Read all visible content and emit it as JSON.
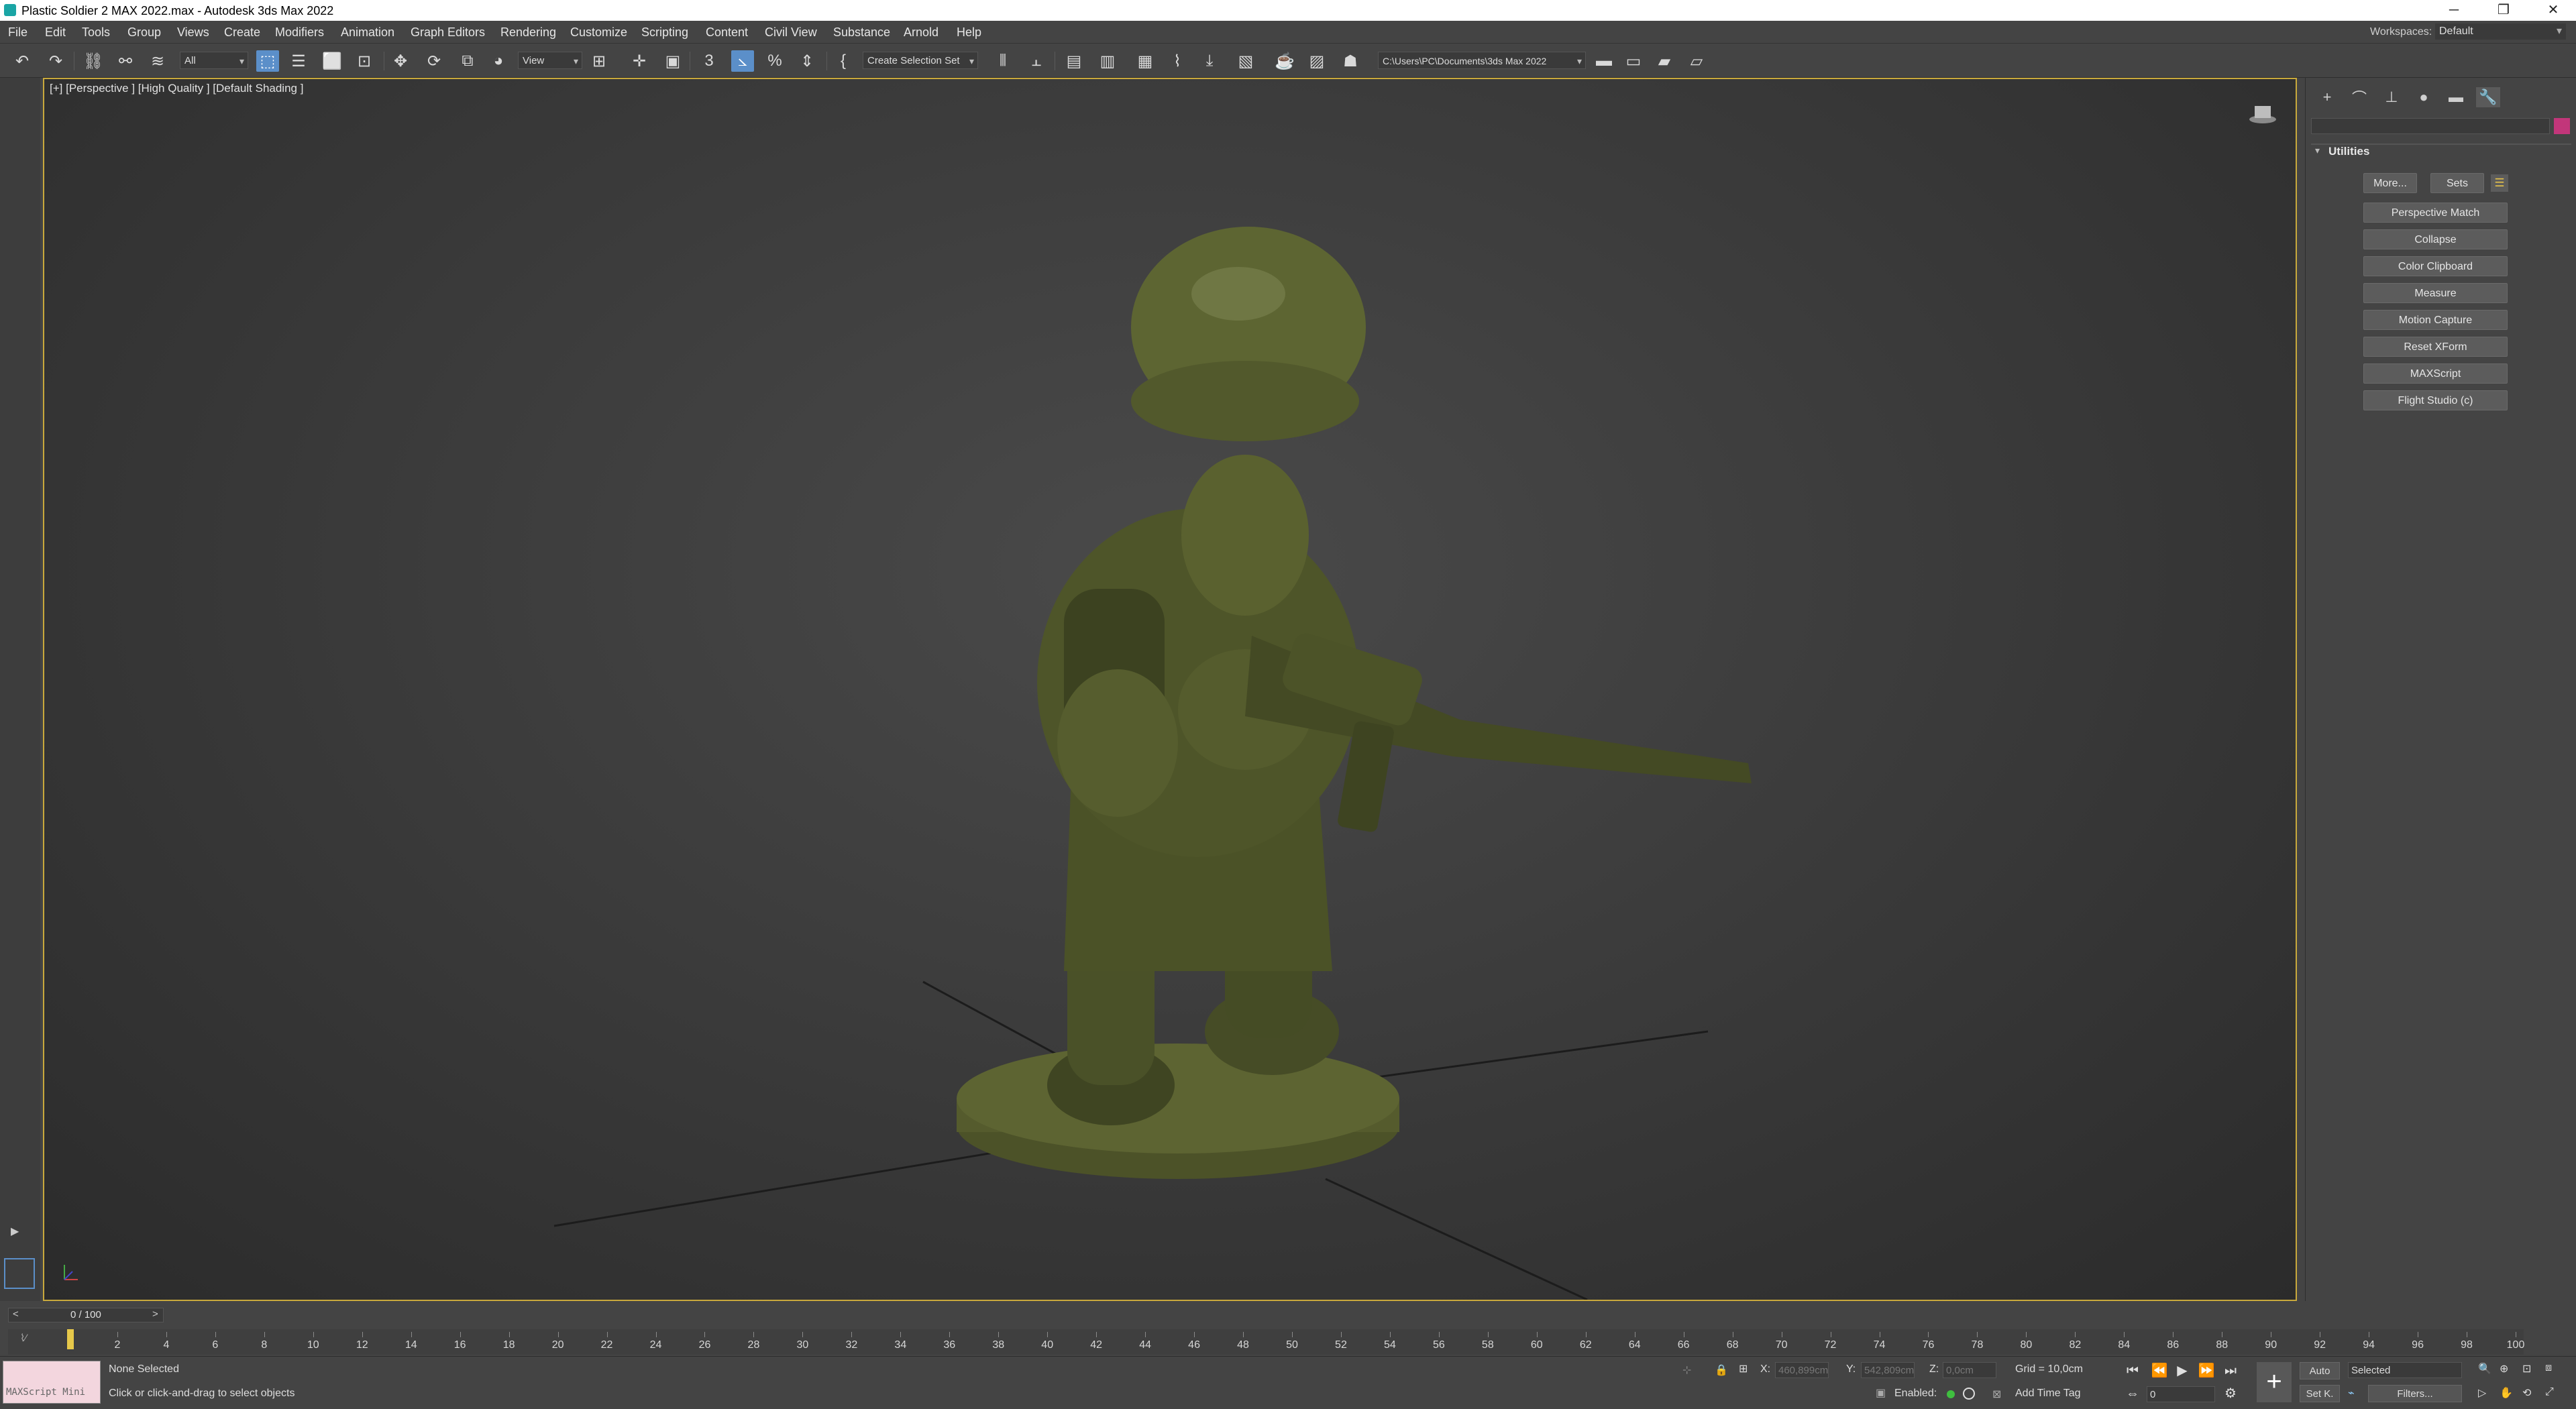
{
  "window": {
    "title": "Plastic Soldier 2 MAX 2022.max - Autodesk 3ds Max 2022",
    "minimize": "─",
    "restore": "❐",
    "close": "✕"
  },
  "menu": [
    "File",
    "Edit",
    "Tools",
    "Group",
    "Views",
    "Create",
    "Modifiers",
    "Animation",
    "Graph Editors",
    "Rendering",
    "Customize",
    "Scripting",
    "Content",
    "Civil View",
    "Substance",
    "Arnold",
    "Help"
  ],
  "workspaces": {
    "label": "Workspaces:",
    "value": "Default"
  },
  "toolbar": {
    "filter_value": "All",
    "refcoord_value": "View",
    "selection_set_placeholder": "Create Selection Set",
    "project_path": "C:\\Users\\PC\\Documents\\3ds Max 2022",
    "snap_label": "3",
    "angle_snap_label": "%"
  },
  "viewport": {
    "label": "[+] [Perspective ] [High Quality ] [Default Shading ]"
  },
  "command_panel": {
    "rollout_title": "Utilities",
    "more_button": "More...",
    "sets_button": "Sets",
    "buttons": [
      "Perspective Match",
      "Collapse",
      "Color Clipboard",
      "Measure",
      "Motion Capture",
      "Reset XForm",
      "MAXScript",
      "Flight Studio (c)"
    ],
    "accent_color": "#c2367a"
  },
  "timeline": {
    "frame_display": "0 / 100",
    "prev": "<",
    "next": ">",
    "ticks": [
      "2",
      "4",
      "6",
      "8",
      "10",
      "12",
      "14",
      "16",
      "18",
      "20",
      "22",
      "24",
      "26",
      "28",
      "30",
      "32",
      "34",
      "36",
      "38",
      "40",
      "42",
      "44",
      "46",
      "48",
      "50",
      "52",
      "54",
      "56",
      "58",
      "60",
      "62",
      "64",
      "66",
      "68",
      "70",
      "72",
      "74",
      "76",
      "78",
      "80",
      "82",
      "84",
      "86",
      "88",
      "90",
      "92",
      "94",
      "96",
      "98",
      "100"
    ]
  },
  "status": {
    "maxscript_label": "MAXScript Mini",
    "selection": "None Selected",
    "prompt": "Click or click-and-drag to select objects",
    "x_label": "X:",
    "x_value": "460,899cm",
    "y_label": "Y:",
    "y_value": "542,809cm",
    "z_label": "Z:",
    "z_value": "0,0cm",
    "grid": "Grid = 10,0cm",
    "enabled_label": "Enabled:",
    "add_time_tag": "Add Time Tag",
    "auto_button": "Auto",
    "setk_button": "Set K.",
    "key_filter_value": "Selected",
    "filters_button": "Filters...",
    "frame_field": "0"
  }
}
